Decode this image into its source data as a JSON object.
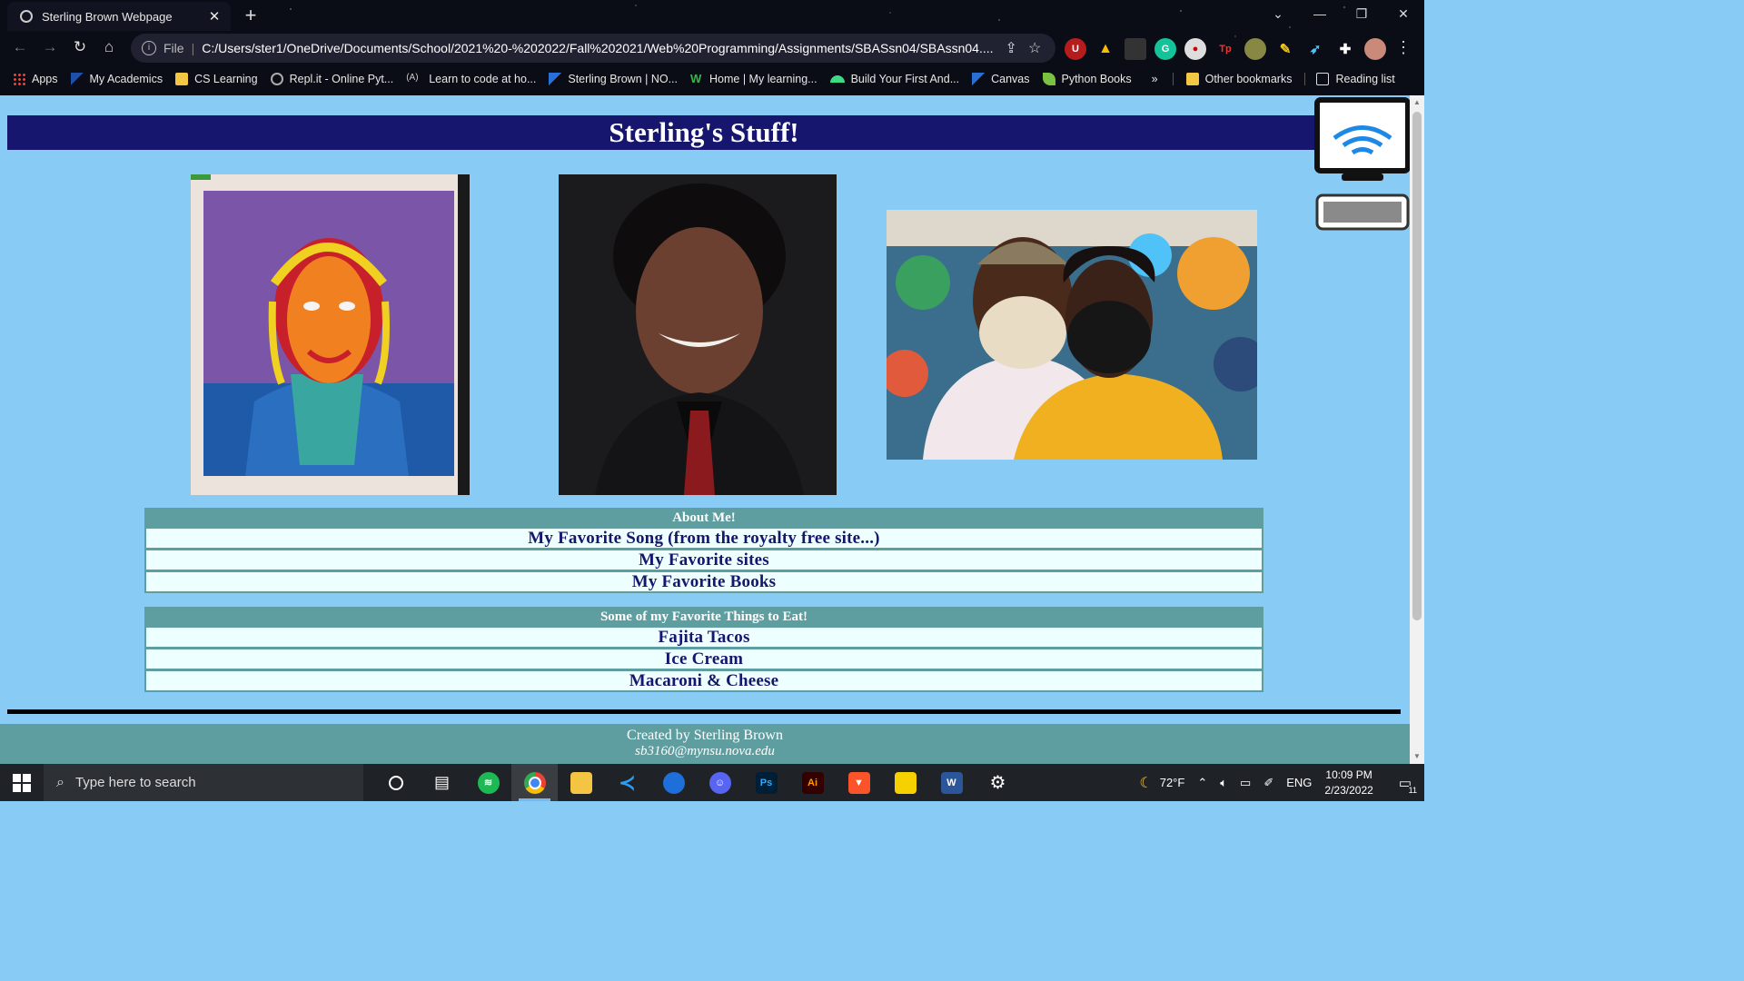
{
  "browser": {
    "tab_title": "Sterling Brown Webpage",
    "close_tab": "✕",
    "new_tab": "+",
    "file_label": "File",
    "url": "C:/Users/ster1/OneDrive/Documents/School/2021%20-%202022/Fall%202021/Web%20Programming/Assignments/SBASsn04/SBAssn04....",
    "bookmarks": [
      {
        "label": "Apps",
        "icon": "apps-grid-icon",
        "color": "#e8453c"
      },
      {
        "label": "My Academics",
        "icon": "nsu-icon",
        "color": "#1f4fa8"
      },
      {
        "label": "CS Learning",
        "icon": "folder-icon",
        "color": "#f2c744"
      },
      {
        "label": "Repl.it - Online Pyt...",
        "icon": "replit-icon",
        "color": "#aaaaaa"
      },
      {
        "label": "Learn to code at ho...",
        "icon": "code-icon",
        "color": "#cccccc"
      },
      {
        "label": "Sterling Brown | NO...",
        "icon": "nsu-icon",
        "color": "#2a6fd6"
      },
      {
        "label": "Home | My learning...",
        "icon": "w-icon",
        "color": "#3ab54a"
      },
      {
        "label": "Build Your First And...",
        "icon": "android-icon",
        "color": "#3ddc84"
      },
      {
        "label": "Canvas",
        "icon": "canvas-icon",
        "color": "#2a6fd6"
      },
      {
        "label": "Python Books",
        "icon": "leaf-icon",
        "color": "#7cc242"
      }
    ],
    "more_bookmarks": "»",
    "other_bookmarks": "Other bookmarks",
    "reading_list": "Reading list"
  },
  "page": {
    "heading": "Sterling's Stuff!",
    "about_table": {
      "header": "About Me!",
      "rows": [
        "My Favorite Song (from the royalty free site...)",
        "My Favorite sites",
        "My Favorite Books"
      ]
    },
    "food_table": {
      "header": "Some of my Favorite Things to Eat!",
      "rows": [
        "Fajita Tacos",
        "Ice Cream",
        "Macaroni & Cheese"
      ]
    },
    "footer": {
      "created_by": "Created by Sterling Brown",
      "email": "sb3160@mynsu.nova.edu"
    }
  },
  "taskbar": {
    "search_placeholder": "Type here to search",
    "weather": "72°F",
    "language": "ENG",
    "time": "10:09 PM",
    "date": "2/23/2022",
    "notification_count": "11"
  },
  "colors": {
    "page_bg": "#88cbf5",
    "header_bg": "#17166e",
    "table_bg": "#5f9ea0",
    "row_bg": "#eeffff"
  }
}
